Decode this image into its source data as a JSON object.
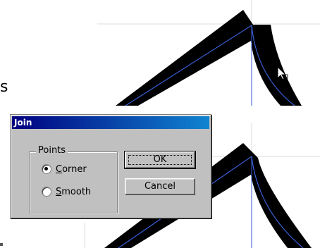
{
  "partial_text": "s",
  "dialog": {
    "title": "Join",
    "group_label": "Points",
    "options": [
      {
        "label": "Corner",
        "underline": "C",
        "rest": "orner",
        "selected": true
      },
      {
        "label": "Smooth",
        "underline": "S",
        "rest": "mooth",
        "selected": false
      }
    ],
    "ok_label": "OK",
    "cancel_label": "Cancel"
  },
  "colors": {
    "stroke": "#000000",
    "path_guide": "#3a5fd8",
    "guide_line": "#dcdcdc",
    "title_gradient_start": "#000080",
    "title_gradient_end": "#1084d0",
    "dialog_face": "#c0c0c0"
  },
  "icons": [
    "mouse-pointer-cursor-icon"
  ]
}
